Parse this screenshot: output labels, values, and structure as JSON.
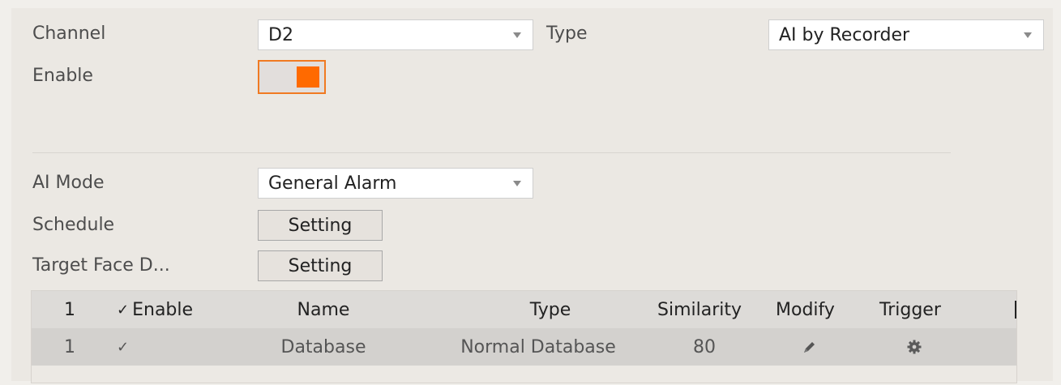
{
  "form": {
    "channel_label": "Channel",
    "channel_value": "D2",
    "type_label": "Type",
    "type_value": "AI by Recorder",
    "enable_label": "Enable",
    "enable_on": true,
    "ai_mode_label": "AI Mode",
    "ai_mode_value": "General Alarm",
    "schedule_label": "Schedule",
    "schedule_button": "Setting",
    "target_face_label": "Target Face D...",
    "target_face_button": "Setting"
  },
  "table": {
    "headers": {
      "index": "1",
      "enable": "Enable",
      "name": "Name",
      "type": "Type",
      "similarity": "Similarity",
      "modify": "Modify",
      "trigger": "Trigger"
    },
    "rows": [
      {
        "index": "1",
        "checked": true,
        "name": "Database",
        "type": "Normal Database",
        "similarity": "80",
        "modify_icon": "pencil-icon",
        "trigger_icon": "gear-icon"
      }
    ]
  },
  "colors": {
    "accent": "#ff6a00",
    "toggle_border": "#f07a22"
  }
}
